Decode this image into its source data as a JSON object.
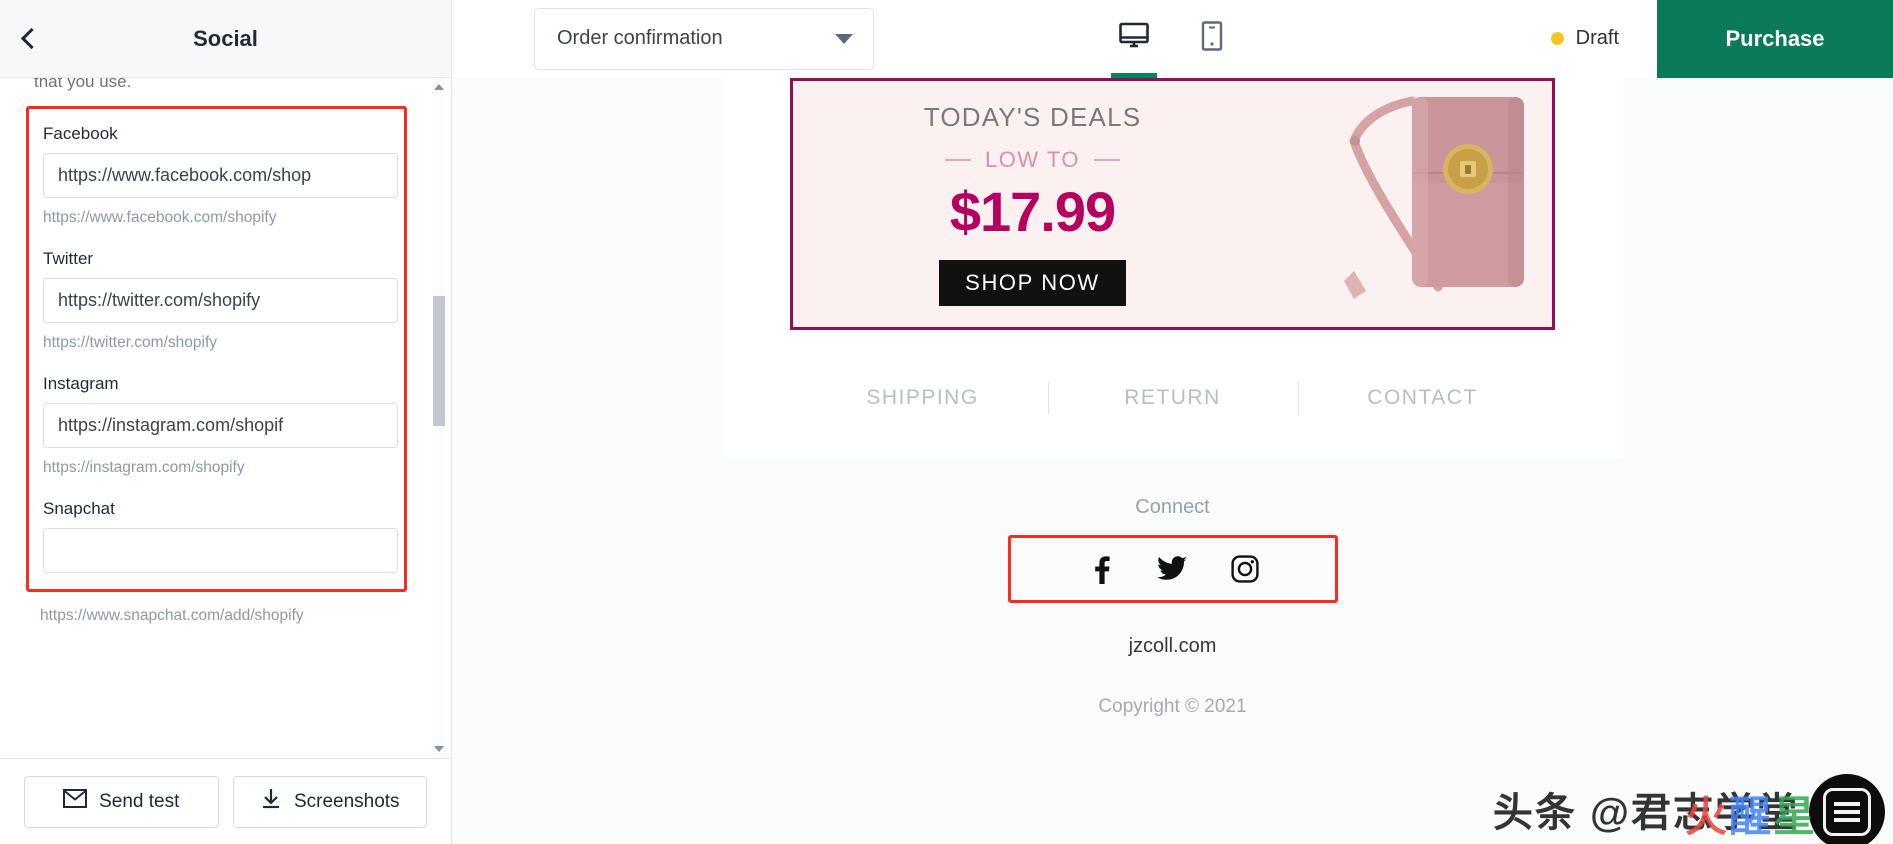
{
  "left_panel": {
    "header": {
      "title": "Social",
      "back_icon": "chevron-left-icon"
    },
    "cut_off_text": "that you use.",
    "fields": [
      {
        "label": "Facebook",
        "value": "https://www.facebook.com/shop",
        "help": "https://www.facebook.com/shopify",
        "placeholder": ""
      },
      {
        "label": "Twitter",
        "value": "https://twitter.com/shopify",
        "help": "https://twitter.com/shopify",
        "placeholder": ""
      },
      {
        "label": "Instagram",
        "value": "https://instagram.com/shopif",
        "help": "https://instagram.com/shopify",
        "placeholder": ""
      },
      {
        "label": "Snapchat",
        "value": "",
        "help": "https://www.snapchat.com/add/shopify",
        "placeholder": ""
      }
    ],
    "footer": {
      "send_test": "Send test",
      "send_test_icon": "envelope-icon",
      "screenshots": "Screenshots",
      "screenshots_icon": "download-icon"
    }
  },
  "topbar": {
    "template_select": "Order confirmation",
    "caret_icon": "chevron-down-icon",
    "devices": [
      {
        "name": "desktop-icon",
        "active": true
      },
      {
        "name": "mobile-icon",
        "active": false
      }
    ],
    "status_label": "Draft",
    "status_color": "#f4c621",
    "purchase_label": "Purchase",
    "purchase_color": "#0b7a5a",
    "active_tab_color": "#00865a"
  },
  "preview": {
    "banner": {
      "eyebrow": "TODAY'S DEALS",
      "subtitle": "LOW TO",
      "price": "$17.99",
      "cta": "SHOP NOW",
      "border_color": "#8e1055",
      "bg_color": "#fbf1f1",
      "price_color": "#b5005f",
      "product_alt": "pink-crossbody-bag-image"
    },
    "footer_links": [
      "SHIPPING",
      "RETURN",
      "CONTACT"
    ],
    "connect_label": "Connect",
    "social_icons": [
      "facebook-icon",
      "twitter-icon",
      "instagram-icon"
    ],
    "site_name": "jzcoll.com",
    "copyright": "Copyright © 2021",
    "highlight_color": "#fb2c1d"
  },
  "watermark": {
    "text": "头条 @君志学堂",
    "overlay": [
      "火",
      "醒",
      "星"
    ]
  }
}
